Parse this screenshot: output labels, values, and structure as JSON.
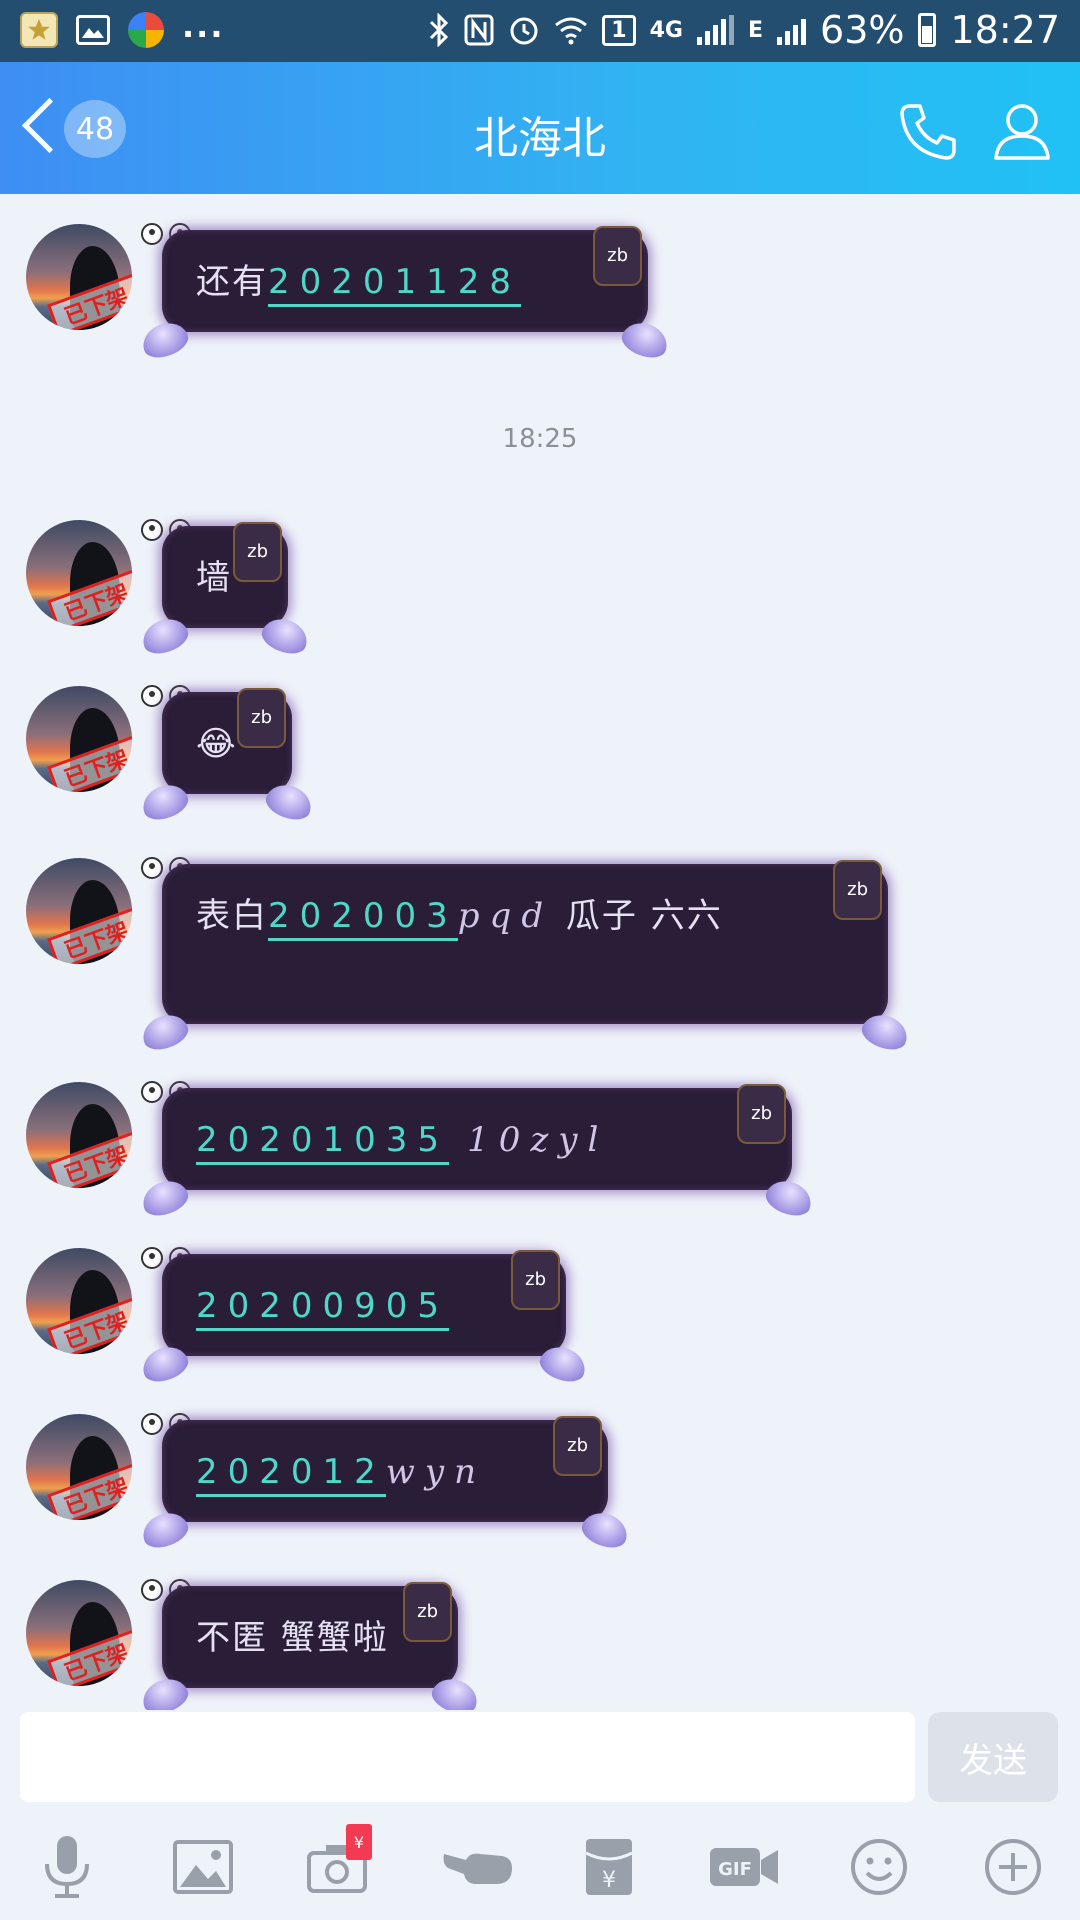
{
  "status_bar": {
    "signal_4g": "4G",
    "sim_slot": "1",
    "network_e": "E",
    "battery": "63%",
    "time": "18:27",
    "dots": "..."
  },
  "header": {
    "unread_count": "48",
    "title": "北海北"
  },
  "timestamp": "18:25",
  "stamp_text": "已下架",
  "zb_tag": "zb",
  "messages": [
    {
      "text": "还有",
      "digits": "20201128",
      "hand": ""
    },
    {
      "text": "墙",
      "digits": "",
      "hand": ""
    },
    {
      "text": "😂",
      "digits": "",
      "hand": ""
    },
    {
      "text": "表白",
      "digits": "202003",
      "hand": "pqd",
      "text2": " 瓜子 六六"
    },
    {
      "text": "",
      "digits": "20201035",
      "hand": "10zyl"
    },
    {
      "text": "",
      "digits": "20200905",
      "hand": ""
    },
    {
      "text": "",
      "digits": "202012",
      "hand": "wyn"
    },
    {
      "text": "不匿 蟹蟹啦",
      "digits": "",
      "hand": ""
    }
  ],
  "input": {
    "placeholder": "",
    "send_label": "发送"
  },
  "toolbar": {
    "red_packet_symbol": "¥",
    "gif_label": "GIF"
  },
  "colors": {
    "header_start": "#3e8ef3",
    "header_end": "#20c1f5",
    "bubble_bg": "#2a1d37",
    "digit_color": "#4fd8c8"
  }
}
